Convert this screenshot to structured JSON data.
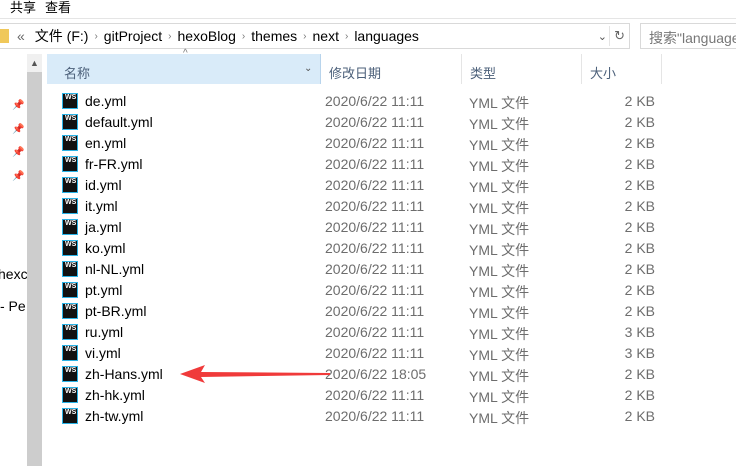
{
  "ribbon": {
    "tabs": [
      "共享",
      "查看"
    ]
  },
  "address": {
    "crumbs": [
      "文件 (F:)",
      "gitProject",
      "hexoBlog",
      "themes",
      "next",
      "languages"
    ],
    "overflow": "«"
  },
  "search": {
    "placeholder": "搜索\"languages\""
  },
  "nav": {
    "partial_items": [
      "hexc",
      "- Pe"
    ]
  },
  "columns": {
    "name": "名称",
    "date": "修改日期",
    "type": "类型",
    "size": "大小"
  },
  "files": [
    {
      "name": "de.yml",
      "date": "2020/6/22 11:11",
      "type": "YML 文件",
      "size": "2 KB"
    },
    {
      "name": "default.yml",
      "date": "2020/6/22 11:11",
      "type": "YML 文件",
      "size": "2 KB"
    },
    {
      "name": "en.yml",
      "date": "2020/6/22 11:11",
      "type": "YML 文件",
      "size": "2 KB"
    },
    {
      "name": "fr-FR.yml",
      "date": "2020/6/22 11:11",
      "type": "YML 文件",
      "size": "2 KB"
    },
    {
      "name": "id.yml",
      "date": "2020/6/22 11:11",
      "type": "YML 文件",
      "size": "2 KB"
    },
    {
      "name": "it.yml",
      "date": "2020/6/22 11:11",
      "type": "YML 文件",
      "size": "2 KB"
    },
    {
      "name": "ja.yml",
      "date": "2020/6/22 11:11",
      "type": "YML 文件",
      "size": "2 KB"
    },
    {
      "name": "ko.yml",
      "date": "2020/6/22 11:11",
      "type": "YML 文件",
      "size": "2 KB"
    },
    {
      "name": "nl-NL.yml",
      "date": "2020/6/22 11:11",
      "type": "YML 文件",
      "size": "2 KB"
    },
    {
      "name": "pt.yml",
      "date": "2020/6/22 11:11",
      "type": "YML 文件",
      "size": "2 KB"
    },
    {
      "name": "pt-BR.yml",
      "date": "2020/6/22 11:11",
      "type": "YML 文件",
      "size": "2 KB"
    },
    {
      "name": "ru.yml",
      "date": "2020/6/22 11:11",
      "type": "YML 文件",
      "size": "3 KB"
    },
    {
      "name": "vi.yml",
      "date": "2020/6/22 11:11",
      "type": "YML 文件",
      "size": "3 KB"
    },
    {
      "name": "zh-Hans.yml",
      "date": "2020/6/22 18:05",
      "type": "YML 文件",
      "size": "2 KB"
    },
    {
      "name": "zh-hk.yml",
      "date": "2020/6/22 11:11",
      "type": "YML 文件",
      "size": "2 KB"
    },
    {
      "name": "zh-tw.yml",
      "date": "2020/6/22 11:11",
      "type": "YML 文件",
      "size": "2 KB"
    }
  ],
  "icon_text": "WS",
  "annotation": {
    "color": "#f03a3a",
    "target": "zh-Hans.yml"
  }
}
